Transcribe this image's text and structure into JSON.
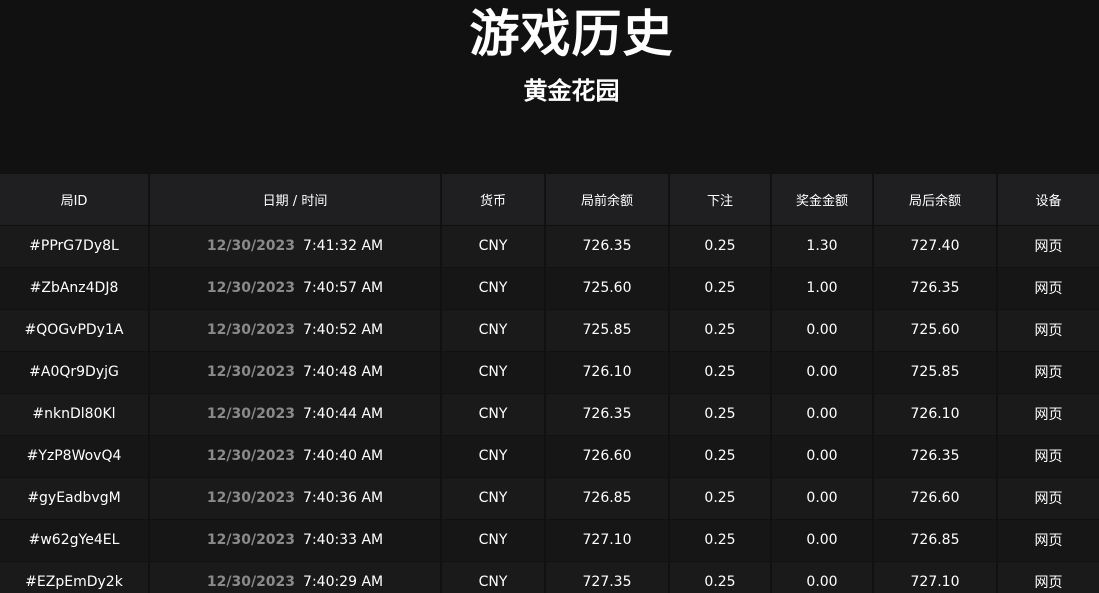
{
  "header": {
    "title": "游戏历史",
    "subtitle": "黄金花园"
  },
  "table": {
    "columns": [
      "局ID",
      "日期 / 时间",
      "货币",
      "局前余额",
      "下注",
      "奖金金额",
      "局后余额",
      "设备"
    ],
    "rows": [
      {
        "id": "#PPrG7Dy8L",
        "date": "12/30/2023",
        "time": "7:41:32 AM",
        "currency": "CNY",
        "balance_before": "726.35",
        "bet": "0.25",
        "win": "1.30",
        "balance_after": "727.40",
        "device": "网页"
      },
      {
        "id": "#ZbAnz4DJ8",
        "date": "12/30/2023",
        "time": "7:40:57 AM",
        "currency": "CNY",
        "balance_before": "725.60",
        "bet": "0.25",
        "win": "1.00",
        "balance_after": "726.35",
        "device": "网页"
      },
      {
        "id": "#QOGvPDy1A",
        "date": "12/30/2023",
        "time": "7:40:52 AM",
        "currency": "CNY",
        "balance_before": "725.85",
        "bet": "0.25",
        "win": "0.00",
        "balance_after": "725.60",
        "device": "网页"
      },
      {
        "id": "#A0Qr9DyjG",
        "date": "12/30/2023",
        "time": "7:40:48 AM",
        "currency": "CNY",
        "balance_before": "726.10",
        "bet": "0.25",
        "win": "0.00",
        "balance_after": "725.85",
        "device": "网页"
      },
      {
        "id": "#nknDl80Kl",
        "date": "12/30/2023",
        "time": "7:40:44 AM",
        "currency": "CNY",
        "balance_before": "726.35",
        "bet": "0.25",
        "win": "0.00",
        "balance_after": "726.10",
        "device": "网页"
      },
      {
        "id": "#YzP8WovQ4",
        "date": "12/30/2023",
        "time": "7:40:40 AM",
        "currency": "CNY",
        "balance_before": "726.60",
        "bet": "0.25",
        "win": "0.00",
        "balance_after": "726.35",
        "device": "网页"
      },
      {
        "id": "#gyEadbvgM",
        "date": "12/30/2023",
        "time": "7:40:36 AM",
        "currency": "CNY",
        "balance_before": "726.85",
        "bet": "0.25",
        "win": "0.00",
        "balance_after": "726.60",
        "device": "网页"
      },
      {
        "id": "#w62gYe4EL",
        "date": "12/30/2023",
        "time": "7:40:33 AM",
        "currency": "CNY",
        "balance_before": "727.10",
        "bet": "0.25",
        "win": "0.00",
        "balance_after": "726.85",
        "device": "网页"
      },
      {
        "id": "#EZpEmDy2k",
        "date": "12/30/2023",
        "time": "7:40:29 AM",
        "currency": "CNY",
        "balance_before": "727.35",
        "bet": "0.25",
        "win": "0.00",
        "balance_after": "727.10",
        "device": "网页"
      }
    ]
  }
}
